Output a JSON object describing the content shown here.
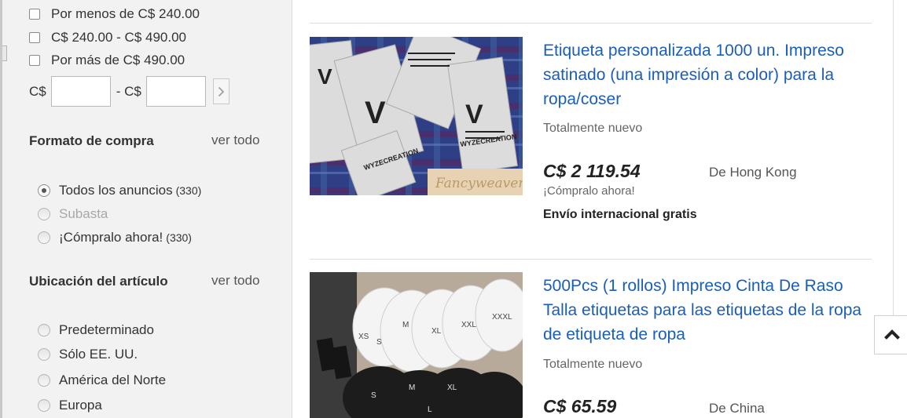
{
  "price_filter": {
    "options": [
      {
        "label": "Por menos de C$ 240.00"
      },
      {
        "label": "C$ 240.00 - C$ 490.00"
      },
      {
        "label": "Por más de C$ 490.00"
      }
    ],
    "min_prefix": "C$",
    "max_prefix": "- C$",
    "min_value": "",
    "max_value": "",
    "go_icon": "chevron-right-icon"
  },
  "format_filter": {
    "heading": "Formato de compra",
    "see_all": "ver todo",
    "options": [
      {
        "label": "Todos los anuncios",
        "count": "(330)",
        "selected": true
      },
      {
        "label": "Subasta",
        "count": "",
        "disabled": true
      },
      {
        "label": "¡Cómpralo ahora!",
        "count": "(330)"
      }
    ]
  },
  "location_filter": {
    "heading": "Ubicación del artículo",
    "see_all": "ver todo",
    "options": [
      {
        "label": "Predeterminado"
      },
      {
        "label": "Sólo EE. UU."
      },
      {
        "label": "América del Norte"
      },
      {
        "label": "Europa"
      }
    ]
  },
  "listings": [
    {
      "title": "Etiqueta personalizada 1000 un. Impreso satinado (una impresión a color) para la ropa/coser",
      "condition": "Totalmente nuevo",
      "price": "C$ 2 119.54",
      "origin": "De Hong Kong",
      "buy_format": "¡Cómpralo ahora!",
      "shipping": "Envío internacional gratis",
      "image_text": "WYZECREATION",
      "image_watermark": "Fancyweaver"
    },
    {
      "title": "500Pcs (1 rollos) Impreso Cinta De Raso Talla etiquetas para las etiquetas de la ropa de etiqueta de ropa",
      "condition": "Totalmente nuevo",
      "price": "C$ 65.59",
      "origin": "De China",
      "image_sizes": [
        "XS",
        "S",
        "M",
        "L",
        "XL",
        "XXL",
        "XXXL"
      ]
    }
  ],
  "scroll_top_icon": "chevron-up-icon",
  "colors": {
    "link": "#1a5eb8",
    "sidebar_bg": "#f2f2f2"
  }
}
